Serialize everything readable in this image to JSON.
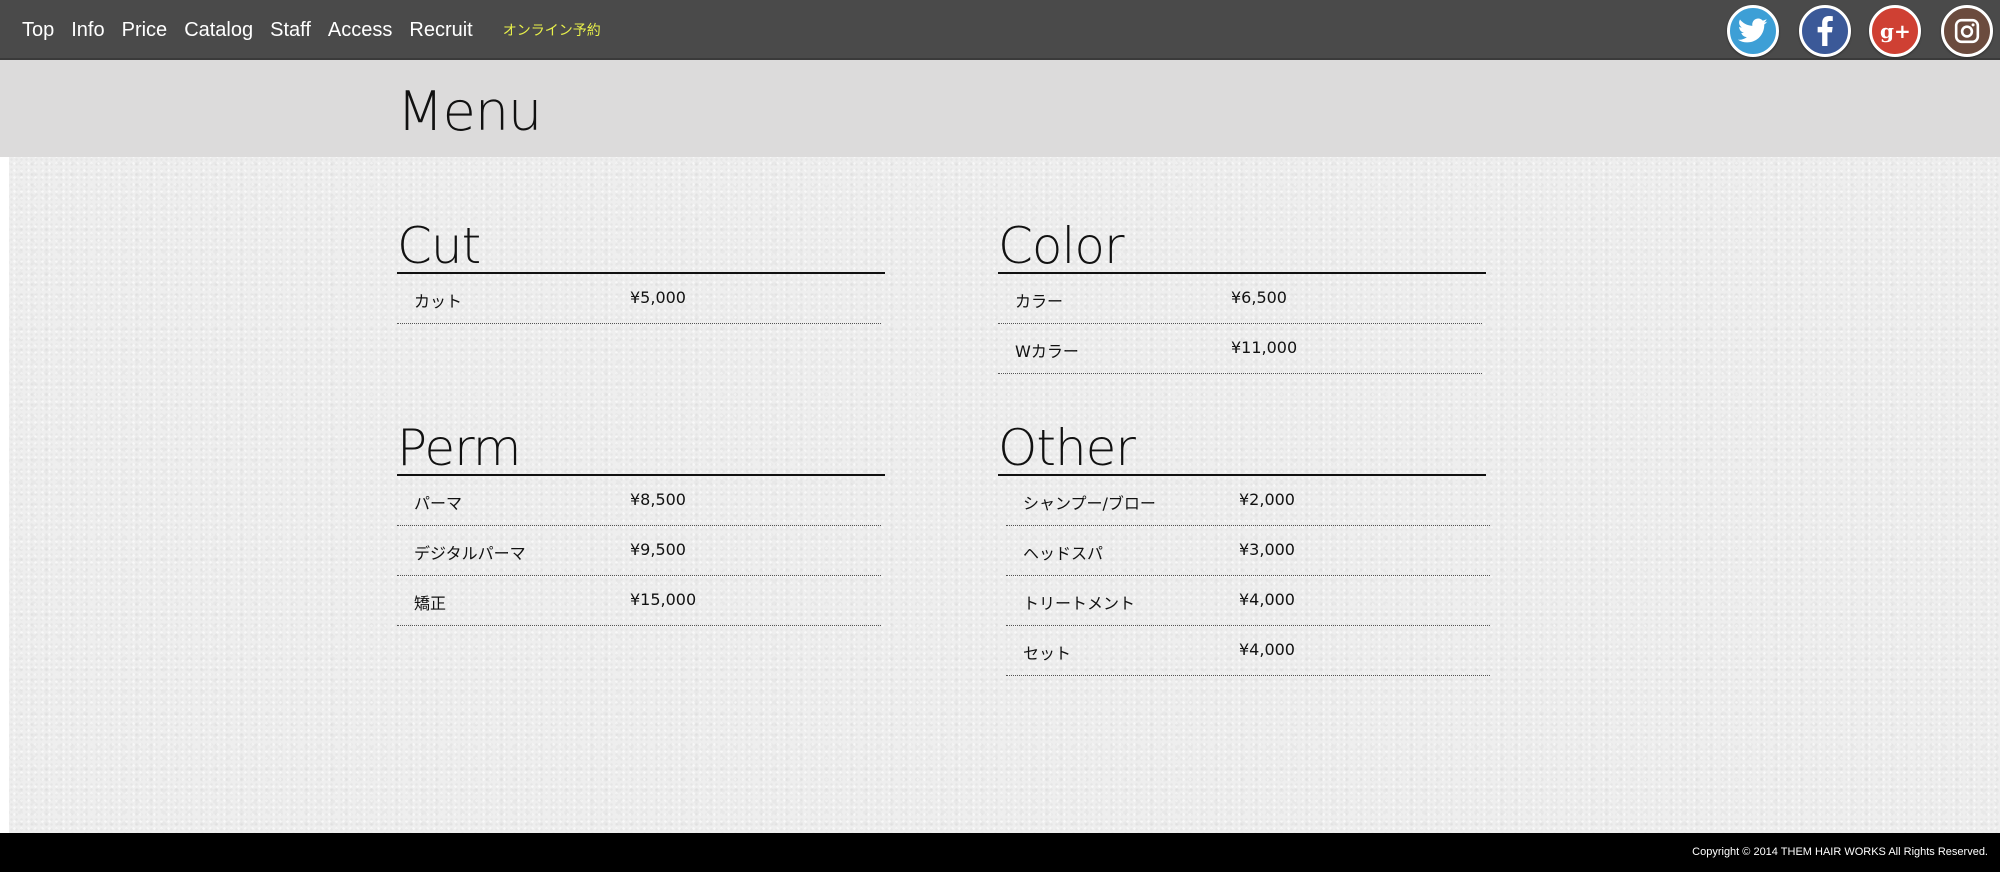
{
  "nav": {
    "items": [
      {
        "label": "Top"
      },
      {
        "label": "Info"
      },
      {
        "label": "Price"
      },
      {
        "label": "Catalog"
      },
      {
        "label": "Staff"
      },
      {
        "label": "Access"
      },
      {
        "label": "Recruit"
      }
    ],
    "reserve_label": "オンライン予約"
  },
  "social": [
    {
      "icon": "twitter-icon",
      "color": "#3d9fd6"
    },
    {
      "icon": "facebook-icon",
      "color": "#3b5998"
    },
    {
      "icon": "google-plus-icon",
      "color": "#cf4033"
    },
    {
      "icon": "instagram-icon",
      "color": "#6b4b3e"
    }
  ],
  "page": {
    "title": "Menu"
  },
  "sections": {
    "cut": {
      "title": "Cut",
      "items": [
        {
          "name": "カット",
          "price": "¥5,000"
        }
      ]
    },
    "color": {
      "title": "Color",
      "items": [
        {
          "name": "カラー",
          "price": "¥6,500"
        },
        {
          "name": "Wカラー",
          "price": "¥11,000"
        }
      ]
    },
    "perm": {
      "title": "Perm",
      "items": [
        {
          "name": "パーマ",
          "price": "¥8,500"
        },
        {
          "name": "デジタルパーマ",
          "price": "¥9,500"
        },
        {
          "name": "矯正",
          "price": "¥15,000"
        }
      ]
    },
    "other": {
      "title": "Other",
      "items": [
        {
          "name": "シャンプー/ブロー",
          "price": "¥2,000"
        },
        {
          "name": "ヘッドスパ",
          "price": "¥3,000"
        },
        {
          "name": "トリートメント",
          "price": "¥4,000"
        },
        {
          "name": "セット",
          "price": "¥4,000"
        }
      ]
    }
  },
  "footer": {
    "copyright": "Copyright © 2014  THEM HAIR WORKS All Rights Reserved."
  }
}
